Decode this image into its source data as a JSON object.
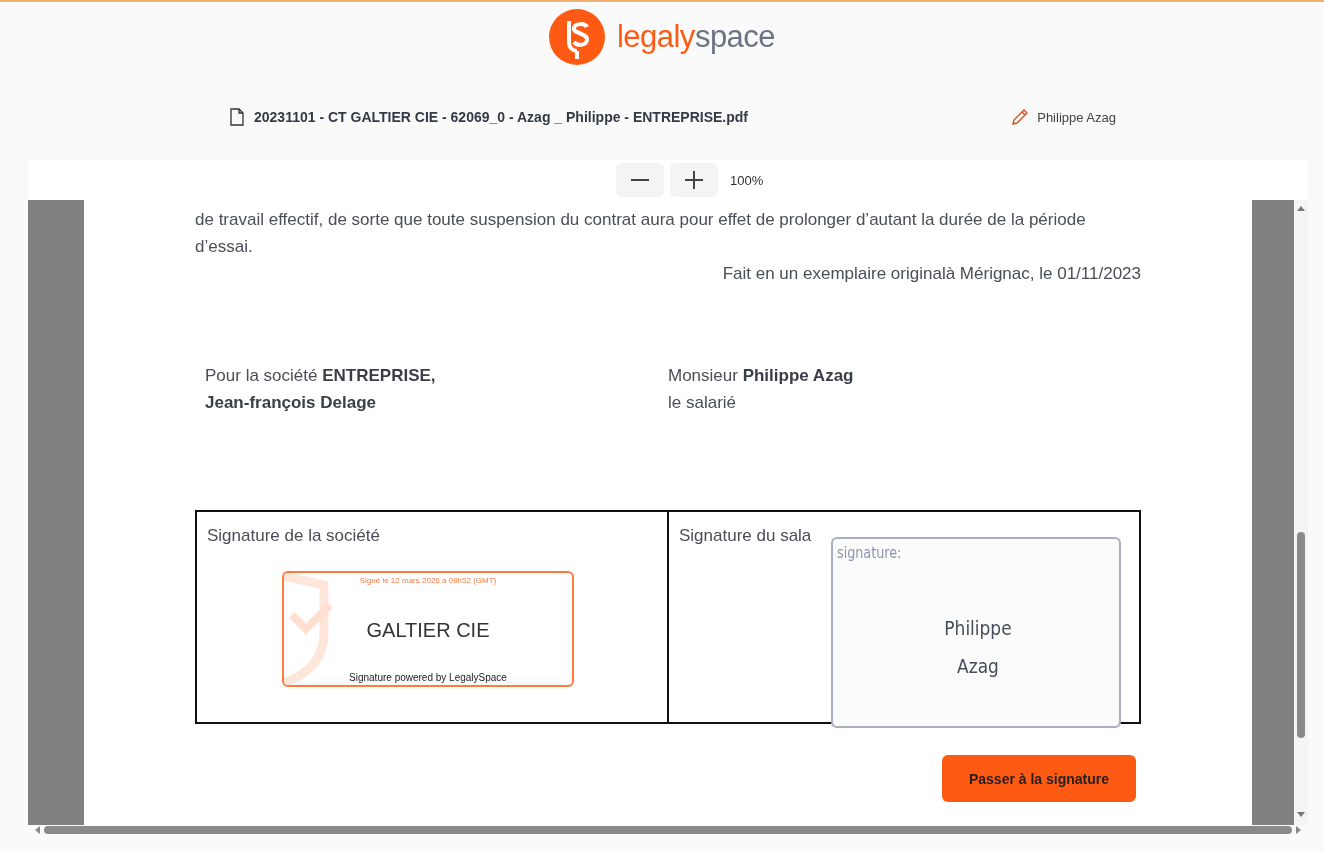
{
  "logo": {
    "primary": "legaly",
    "secondary": "space"
  },
  "file": {
    "name": "20231101 - CT GALTIER CIE - 62069_0 - Azag _ Philippe - ENTREPRISE.pdf"
  },
  "signer": {
    "name": "Philippe Azag"
  },
  "zoom": {
    "value": "100%"
  },
  "document": {
    "paragraph": "de travail effectif, de sorte que toute suspension du contrat aura pour effet de prolonger d’autant la durée de la période d’essai.",
    "place_date": "Fait en un exemplaire originalà Mérignac, le 01/11/2023",
    "parties": [
      "Pour la société **ENTREPRISE, Jean-françois Delage**",
      "Monsieur **Philippe Azag** le salarié"
    ],
    "signature_cells": [
      {
        "kind": "stamp",
        "label": "Signature de la société",
        "signed_at": "Signé le 12 mars 2026 à 09h52 (GMT)",
        "name": "GALTIER CIE",
        "footer": "Signature powered by LegalySpace"
      },
      {
        "kind": "field",
        "label": "Signature du sala",
        "field_label": "signature:",
        "value": "Philippe Azag"
      }
    ]
  },
  "action": {
    "label": "Passer à la signature"
  }
}
